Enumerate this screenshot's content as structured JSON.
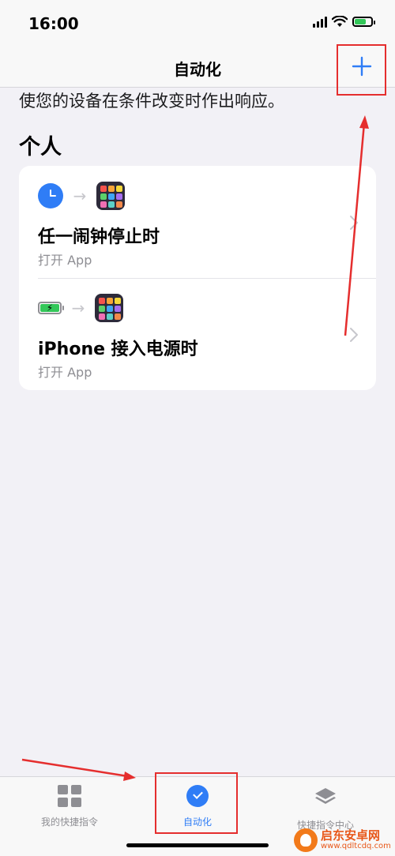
{
  "status_bar": {
    "time": "16:00"
  },
  "nav": {
    "title": "自动化",
    "add_icon": "plus-icon"
  },
  "subtitle": "使您的设备在条件改变时作出响应。",
  "section_title": "个人",
  "automations": [
    {
      "trigger_icon": "alarm-clock-icon",
      "action_icon": "app-grid-icon",
      "title": "任一闹钟停止时",
      "subtitle": "打开 App"
    },
    {
      "trigger_icon": "battery-charging-icon",
      "action_icon": "app-grid-icon",
      "title": "iPhone 接入电源时",
      "subtitle": "打开 App"
    }
  ],
  "tabs": [
    {
      "label": "我的快捷指令",
      "icon": "grid-icon",
      "active": false
    },
    {
      "label": "自动化",
      "icon": "automation-icon",
      "active": true
    },
    {
      "label": "快捷指令中心",
      "icon": "layers-icon",
      "active": false
    }
  ],
  "watermark": {
    "name": "启东安卓网",
    "url": "www.qdltcdq.com"
  },
  "colors": {
    "accent": "#2f7df6",
    "annotation": "#e52e2e",
    "background": "#f2f1f6"
  }
}
